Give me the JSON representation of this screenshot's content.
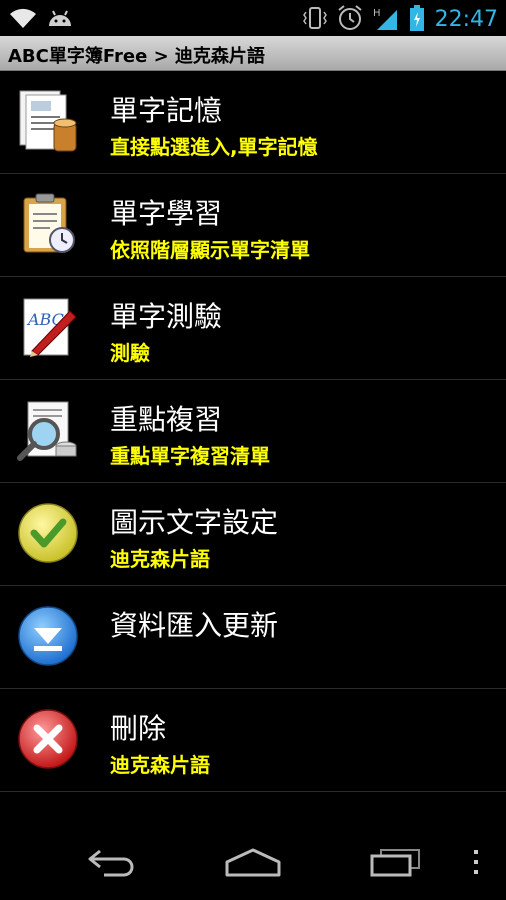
{
  "status_bar": {
    "time": "22:47",
    "left_icons": [
      "wifi-icon",
      "android-icon"
    ],
    "right_icons": [
      "vibrate-icon",
      "alarm-icon",
      "signal-icon",
      "battery-icon"
    ],
    "clock_color": "#33b5e5"
  },
  "title_bar": {
    "text": "ABC單字簿Free > 迪克森片語"
  },
  "menu": {
    "items": [
      {
        "title": "單字記憶",
        "subtitle": "直接點選進入,單字記憶",
        "icon": "document-database-icon"
      },
      {
        "title": "單字學習",
        "subtitle": "依照階層顯示單字清單",
        "icon": "clipboard-clock-icon"
      },
      {
        "title": "單字測驗",
        "subtitle": "測驗",
        "icon": "abc-pen-icon"
      },
      {
        "title": "重點複習",
        "subtitle": "重點單字複習清單",
        "icon": "magnifier-document-icon"
      },
      {
        "title": "圖示文字設定",
        "subtitle": "迪克森片語",
        "icon": "check-icon"
      },
      {
        "title": "資料匯入更新",
        "subtitle": "",
        "icon": "download-arrow-icon"
      },
      {
        "title": "刪除",
        "subtitle": "迪克森片語",
        "icon": "delete-icon"
      }
    ]
  },
  "nav_bar": {
    "buttons": [
      "back-icon",
      "home-icon",
      "recent-apps-icon",
      "overflow-menu-icon"
    ]
  },
  "colors": {
    "subtitle": "#ffff00",
    "background": "#000000"
  }
}
